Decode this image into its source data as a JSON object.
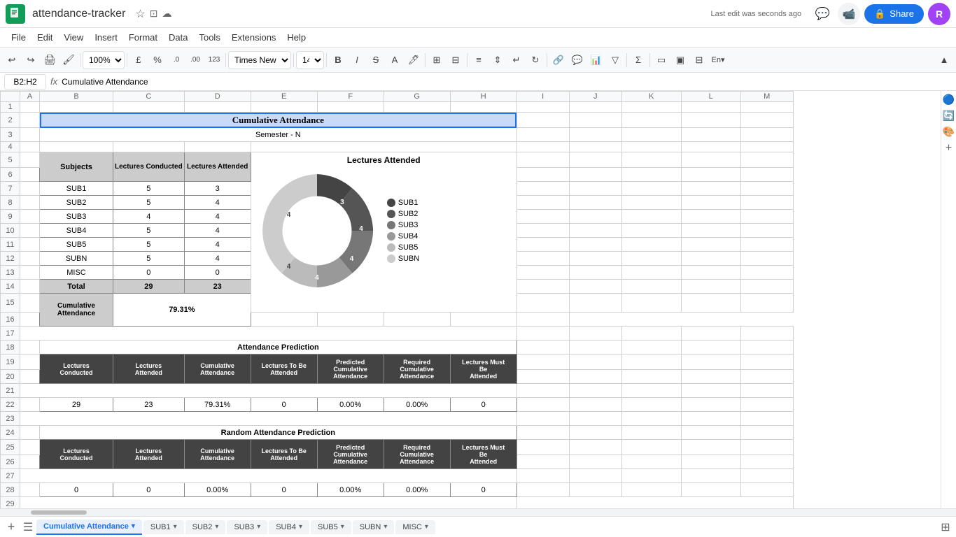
{
  "app": {
    "logo_color": "#0f9d58",
    "title": "attendance-tracker",
    "last_edit": "Last edit was seconds ago",
    "share_label": "Share",
    "user_initial": "R"
  },
  "menu": {
    "items": [
      "File",
      "Edit",
      "View",
      "Insert",
      "Format",
      "Data",
      "Tools",
      "Extensions",
      "Help"
    ]
  },
  "toolbar": {
    "zoom": "100%",
    "font": "Times New...",
    "font_size": "14"
  },
  "formula_bar": {
    "cell_ref": "B2:H2",
    "formula": "Cumulative Attendance"
  },
  "spreadsheet": {
    "col_headers": [
      "",
      "A",
      "B",
      "C",
      "D",
      "E",
      "F",
      "G",
      "H",
      "I",
      "J",
      "K",
      "L",
      "M"
    ],
    "title_row": "Cumulative Attendance",
    "subtitle_row": "Semester - N",
    "table_headers": {
      "subjects": "Subjects",
      "lectures_conducted": "Lectures Conducted",
      "lectures_attended": "Lectures Attended"
    },
    "subjects": [
      "SUB1",
      "SUB2",
      "SUB3",
      "SUB4",
      "SUB5",
      "SUBN",
      "MISC",
      "Total"
    ],
    "lectures_conducted": [
      5,
      5,
      4,
      5,
      5,
      5,
      0,
      29
    ],
    "lectures_attended": [
      3,
      4,
      4,
      4,
      4,
      4,
      0,
      23
    ],
    "cumulative_attendance": "79.31%",
    "chart": {
      "title": "Lectures Attended",
      "segments": [
        {
          "label": "SUB1",
          "value": 3,
          "color": "#444444"
        },
        {
          "label": "SUB2",
          "value": 4,
          "color": "#666666"
        },
        {
          "label": "SUB3",
          "value": 4,
          "color": "#888888"
        },
        {
          "label": "SUB4",
          "value": 4,
          "color": "#aaaaaa"
        },
        {
          "label": "SUB5",
          "value": 4,
          "color": "#cccccc"
        },
        {
          "label": "SUBN",
          "value": 4,
          "color": "#dddddd"
        }
      ]
    },
    "attendance_prediction": {
      "title": "Attendance Prediction",
      "headers": [
        "Lectures Conducted",
        "Lectures Attended",
        "Cumulative Attendance",
        "Lectures To Be Attended",
        "Predicted Cumulative Attendance",
        "Required Cumulative Attendance",
        "Lectures Must Be Attended"
      ],
      "values": [
        29,
        23,
        "79.31%",
        0,
        "0.00%",
        "0.00%",
        0
      ]
    },
    "random_prediction": {
      "title": "Random Attendance Prediction",
      "headers": [
        "Lectures Conducted",
        "Lectures Attended",
        "Cumulative Attendance",
        "Lectures To Be Attended",
        "Predicted Cumulative Attendance",
        "Required Cumulative Attendance",
        "Lectures Must Be Attended"
      ],
      "values": [
        0,
        0,
        "0.00%",
        0,
        "0.00%",
        "0.00%",
        0
      ]
    }
  },
  "tabs": {
    "items": [
      "Cumulative Attendance",
      "SUB1",
      "SUB2",
      "SUB3",
      "SUB4",
      "SUB5",
      "SUBN",
      "MISC"
    ],
    "active": "Cumulative Attendance"
  }
}
